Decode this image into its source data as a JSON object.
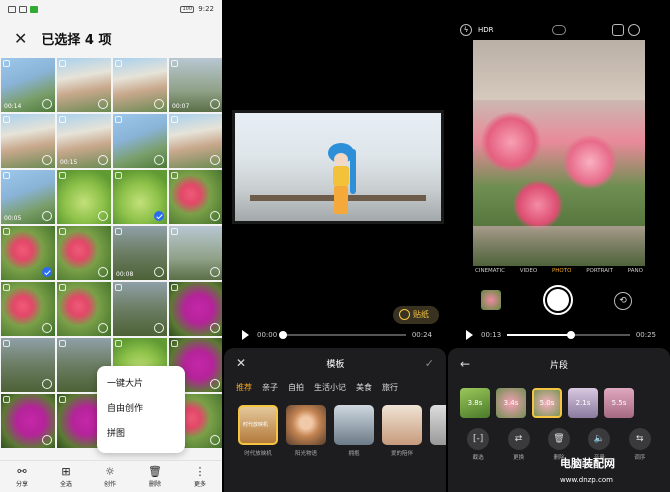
{
  "screen1": {
    "status": {
      "left": "▌ ▌ ᯤ ◔ ♥",
      "time": "9:22",
      "battery": "100"
    },
    "title": "已选择 4 项",
    "close_icon": "close-icon",
    "grid": [
      {
        "c": "c-b",
        "dur": "00:14",
        "sel": false
      },
      {
        "c": "c-c",
        "dur": "",
        "sel": false
      },
      {
        "c": "c-c",
        "dur": "",
        "sel": false
      },
      {
        "c": "c-s",
        "dur": "00:07",
        "sel": false
      },
      {
        "c": "c-c",
        "dur": "",
        "sel": false
      },
      {
        "c": "c-c",
        "dur": "00:15",
        "sel": false
      },
      {
        "c": "c-b",
        "dur": "",
        "sel": false
      },
      {
        "c": "c-c",
        "dur": "",
        "sel": false
      },
      {
        "c": "c-b",
        "dur": "00:05",
        "sel": false
      },
      {
        "c": "c-g",
        "dur": "",
        "sel": false
      },
      {
        "c": "c-g",
        "dur": "",
        "sel": true
      },
      {
        "c": "c-f",
        "dur": "",
        "sel": false
      },
      {
        "c": "c-f",
        "dur": "",
        "sel": true
      },
      {
        "c": "c-f",
        "dur": "",
        "sel": false
      },
      {
        "c": "c-t",
        "dur": "00:08",
        "sel": false
      },
      {
        "c": "c-s",
        "dur": "",
        "sel": false
      },
      {
        "c": "c-f",
        "dur": "",
        "sel": false
      },
      {
        "c": "c-f",
        "dur": "",
        "sel": false
      },
      {
        "c": "c-t",
        "dur": "",
        "sel": false
      },
      {
        "c": "c-m",
        "dur": "",
        "sel": false
      },
      {
        "c": "c-t",
        "dur": "",
        "sel": false
      },
      {
        "c": "c-t",
        "dur": "",
        "sel": false
      },
      {
        "c": "c-g",
        "dur": "",
        "sel": false
      },
      {
        "c": "c-m",
        "dur": "",
        "sel": false
      },
      {
        "c": "c-m",
        "dur": "",
        "sel": false
      },
      {
        "c": "c-m",
        "dur": "",
        "sel": false
      },
      {
        "c": "c-t",
        "dur": "",
        "sel": false
      },
      {
        "c": "c-f",
        "dur": "",
        "sel": false
      }
    ],
    "menu": [
      "一键大片",
      "自由创作",
      "拼图"
    ],
    "bottom": [
      {
        "icon": "share-icon",
        "glyph": "⚯",
        "label": "分享"
      },
      {
        "icon": "select-all-icon",
        "glyph": "⊞",
        "label": "全选"
      },
      {
        "icon": "create-icon",
        "glyph": "☼",
        "label": "创作"
      },
      {
        "icon": "delete-icon",
        "glyph": "🗑",
        "label": "删除"
      },
      {
        "icon": "more-icon",
        "glyph": "⋮",
        "label": "更多"
      }
    ]
  },
  "screen2": {
    "sticker": "贴纸",
    "time_current": "00:00",
    "time_total": "00:24",
    "progress": 0.0,
    "sheet_title": "模板",
    "categories": [
      "推荐",
      "亲子",
      "自拍",
      "生活小记",
      "美食",
      "旅行"
    ],
    "active_category": 0,
    "templates": [
      {
        "cls": "im1",
        "label": "时代放映机",
        "text": "时代放映机",
        "sel": true
      },
      {
        "cls": "im2",
        "label": "阳光物语",
        "text": "",
        "sel": false
      },
      {
        "cls": "im3",
        "label": "拥抱",
        "text": "",
        "sel": false
      },
      {
        "cls": "im4",
        "label": "爱的陪伴",
        "text": "",
        "sel": false
      },
      {
        "cls": "im5",
        "label": "",
        "text": "",
        "sel": false
      }
    ]
  },
  "screen3": {
    "hdr": "HDR",
    "modes": [
      "CINEMATIC",
      "VIDEO",
      "PHOTO",
      "PORTRAIT",
      "PANO"
    ],
    "active_mode": 2,
    "time_current": "00:13",
    "time_total": "00:25",
    "progress": 0.52,
    "sheet_title": "片段",
    "clips": [
      {
        "cls": "cl1",
        "dur": "3.8s",
        "sel": false
      },
      {
        "cls": "cl2",
        "dur": "3.4s",
        "sel": false
      },
      {
        "cls": "cl3",
        "dur": "5.0s",
        "sel": true
      },
      {
        "cls": "cl4",
        "dur": "2.1s",
        "sel": false
      },
      {
        "cls": "cl5",
        "dur": "5.5s",
        "sel": false
      }
    ],
    "tools": [
      {
        "icon": "trim-icon",
        "glyph": "[-]",
        "label": "截选"
      },
      {
        "icon": "replace-icon",
        "glyph": "⇄",
        "label": "更换"
      },
      {
        "icon": "delete-icon",
        "glyph": "🗑",
        "label": "删除"
      },
      {
        "icon": "volume-icon",
        "glyph": "🔈",
        "label": "音量"
      },
      {
        "icon": "swap-icon",
        "glyph": "⇆",
        "label": "调序"
      }
    ]
  },
  "watermark": {
    "line1": "电脑装配网",
    "line2": "www.dnzp.com"
  }
}
